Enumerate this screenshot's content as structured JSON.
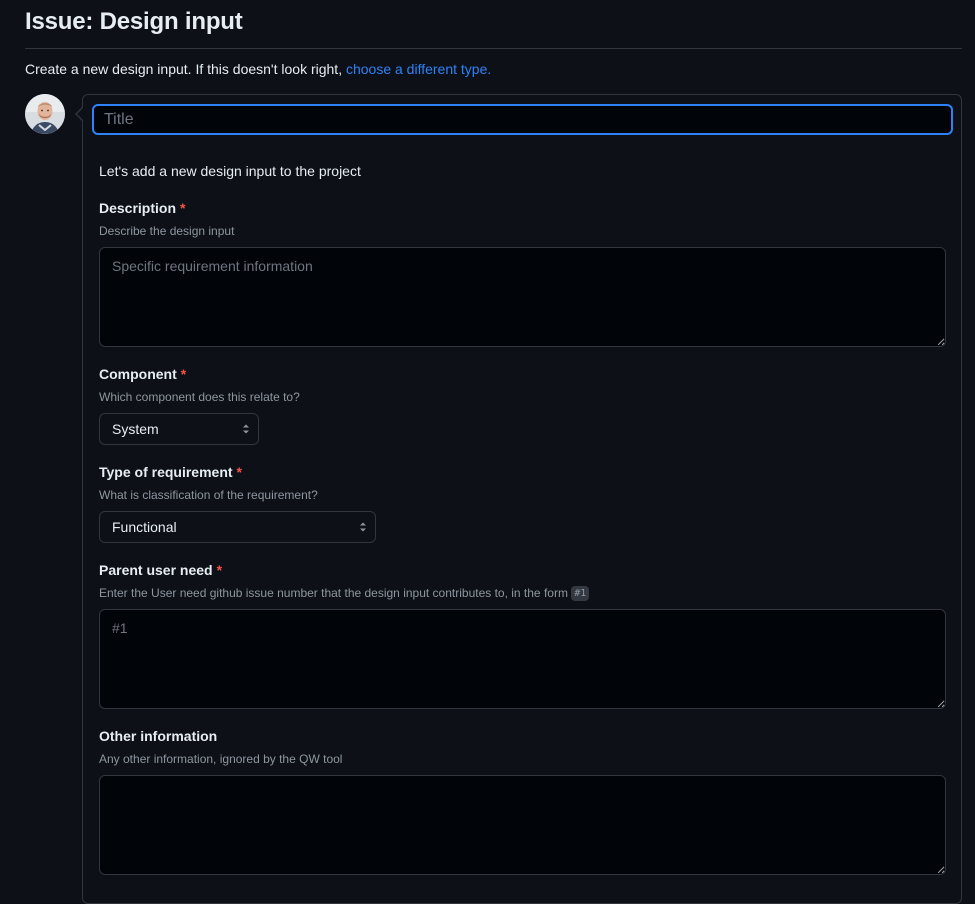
{
  "header": {
    "title": "Issue: Design input"
  },
  "subtitle": {
    "text": "Create a new design input. If this doesn't look right, ",
    "link_label": "choose a different type."
  },
  "form": {
    "title_placeholder": "Title",
    "intro": "Let's add a new design input to the project",
    "required_marker": "*",
    "fields": {
      "description": {
        "label": "Description",
        "hint": "Describe the design input",
        "placeholder": "Specific requirement information"
      },
      "component": {
        "label": "Component",
        "hint": "Which component does this relate to?",
        "selected": "System"
      },
      "type_of_requirement": {
        "label": "Type of requirement",
        "hint": "What is classification of the requirement?",
        "selected": "Functional"
      },
      "parent_user_need": {
        "label": "Parent user need",
        "hint": "Enter the User need github issue number that the design input contributes to, in the form ",
        "hint_code": "#1",
        "placeholder": "#1"
      },
      "other_information": {
        "label": "Other information",
        "hint": "Any other information, ignored by the QW tool",
        "placeholder": ""
      }
    }
  },
  "icons": {
    "select_caret": "chevron-up-down-icon"
  }
}
